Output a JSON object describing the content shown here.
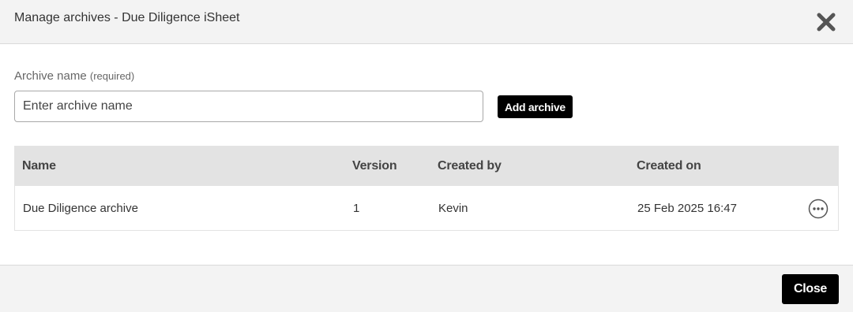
{
  "dialog": {
    "title": "Manage archives - Due Diligence iSheet",
    "close_icon": "close-x-icon"
  },
  "form": {
    "label": "Archive name",
    "required_note": "(required)",
    "placeholder": "Enter archive name",
    "value": "",
    "add_button": "Add archive"
  },
  "table": {
    "columns": [
      "Name",
      "Version",
      "Created by",
      "Created on"
    ],
    "rows": [
      {
        "name": "Due Diligence archive",
        "version": "1",
        "created_by": "Kevin",
        "created_on": "25 Feb 2025 16:47",
        "actions_icon": "more-horizontal-icon"
      }
    ]
  },
  "footer": {
    "close_button": "Close"
  },
  "colors": {
    "header_bg": "#f3f3f3",
    "table_header_bg": "#e3e3e3",
    "button_bg": "#000000",
    "button_text": "#ffffff"
  }
}
